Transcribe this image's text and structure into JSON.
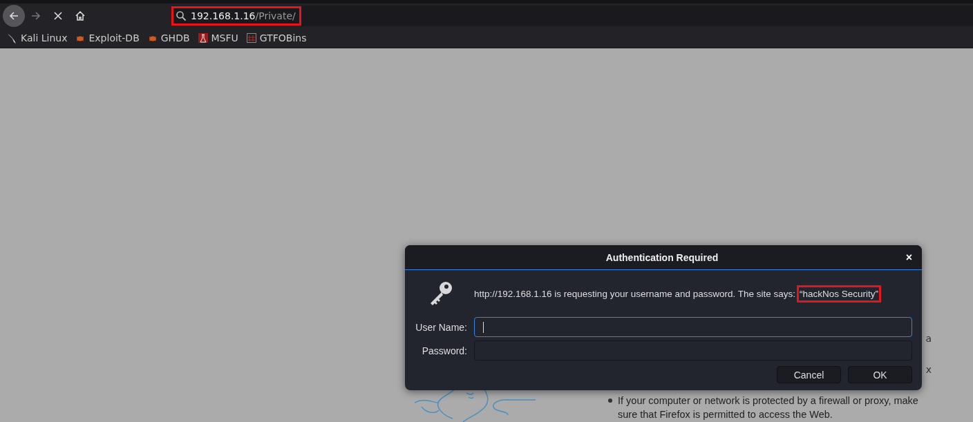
{
  "toolbar": {
    "address": {
      "host": "192.168.1.16",
      "path": "/Private/",
      "highlighted": true
    }
  },
  "bookmarks": [
    {
      "label": "Kali Linux",
      "kind": "kali"
    },
    {
      "label": "Exploit-DB",
      "kind": "bug"
    },
    {
      "label": "GHDB",
      "kind": "bug"
    },
    {
      "label": "MSFU",
      "kind": "msfu"
    },
    {
      "label": "GTFOBins",
      "kind": "gtfo"
    }
  ],
  "page": {
    "line_fragments": [
      "a",
      "x"
    ],
    "bullet": "If your computer or network is protected by a firewall or proxy, make sure that Firefox is permitted to access the Web."
  },
  "dialog": {
    "title": "Authentication Required",
    "close": "×",
    "message": "http://192.168.1.16 is requesting your username and password. The site says:",
    "realm": "“hackNos Security”",
    "realm_highlighted": true,
    "fields": [
      {
        "label": "User Name:",
        "focused": true
      },
      {
        "label": "Password:",
        "focused": false
      }
    ],
    "buttons": [
      "Cancel",
      "OK"
    ]
  }
}
